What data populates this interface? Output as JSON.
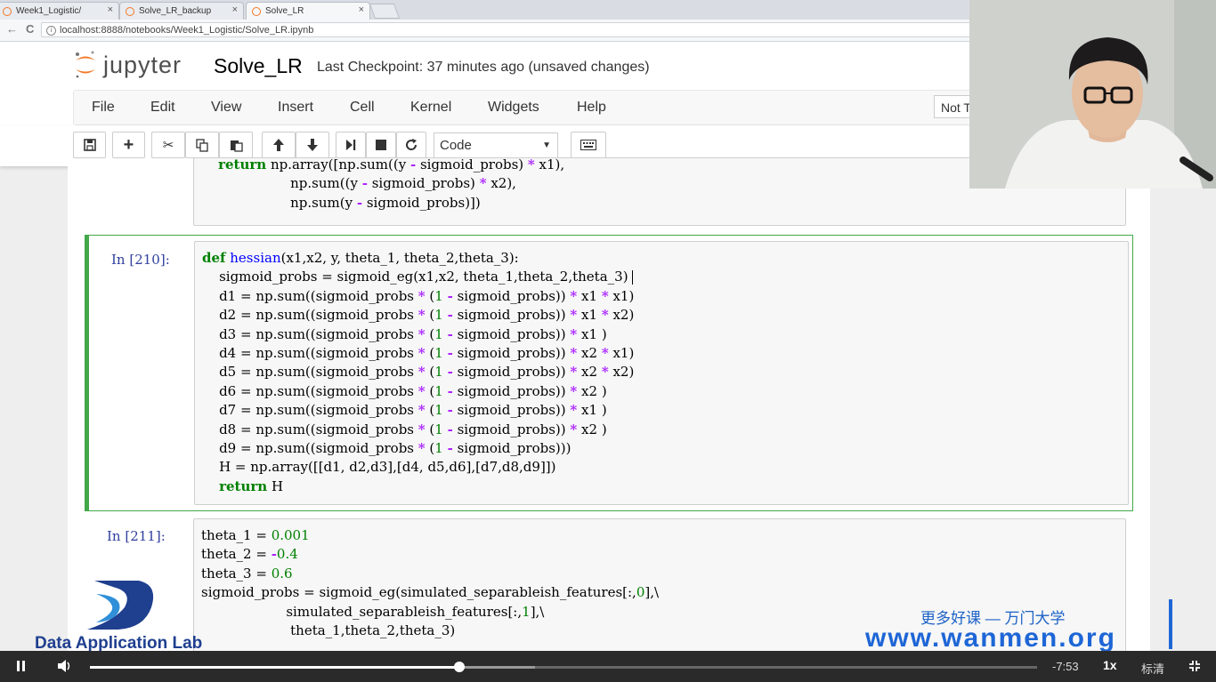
{
  "browser": {
    "tabs": [
      {
        "label": "Week1_Logistic/",
        "close": "×"
      },
      {
        "label": "Solve_LR_backup",
        "close": "×"
      },
      {
        "label": "Solve_LR",
        "close": "×"
      }
    ],
    "url": "localhost:8888/notebooks/Week1_Logistic/Solve_LR.ipynb",
    "back": "←",
    "reload": "C"
  },
  "jupyter": {
    "logo_text": "jupyter",
    "notebook_name": "Solve_LR",
    "checkpoint": "Last Checkpoint: 37 minutes ago (unsaved changes)",
    "menu": [
      "File",
      "Edit",
      "View",
      "Insert",
      "Cell",
      "Kernel",
      "Widgets",
      "Help"
    ],
    "kernel_badge": "Not T",
    "cell_type": "Code",
    "cell_type_caret": "▼"
  },
  "cells": [
    {
      "prompt": "",
      "id": "prev"
    },
    {
      "prompt": "In  [210]:",
      "id": "hessian"
    },
    {
      "prompt": "In  [211]:",
      "id": "theta"
    }
  ],
  "watermark": {
    "left_text": "Data Application Lab",
    "slogan": "更多好课 — 万门大学",
    "url": "www.wanmen.org"
  },
  "player": {
    "progress_fraction": 0.39,
    "remaining_time": "-7:53",
    "speed": "1x",
    "quality": "标清"
  },
  "colors": {
    "selected_cell_border": "#42a849",
    "prompt_color": "#303f9f",
    "keyword": "#008000",
    "operator": "#aa22ff"
  }
}
